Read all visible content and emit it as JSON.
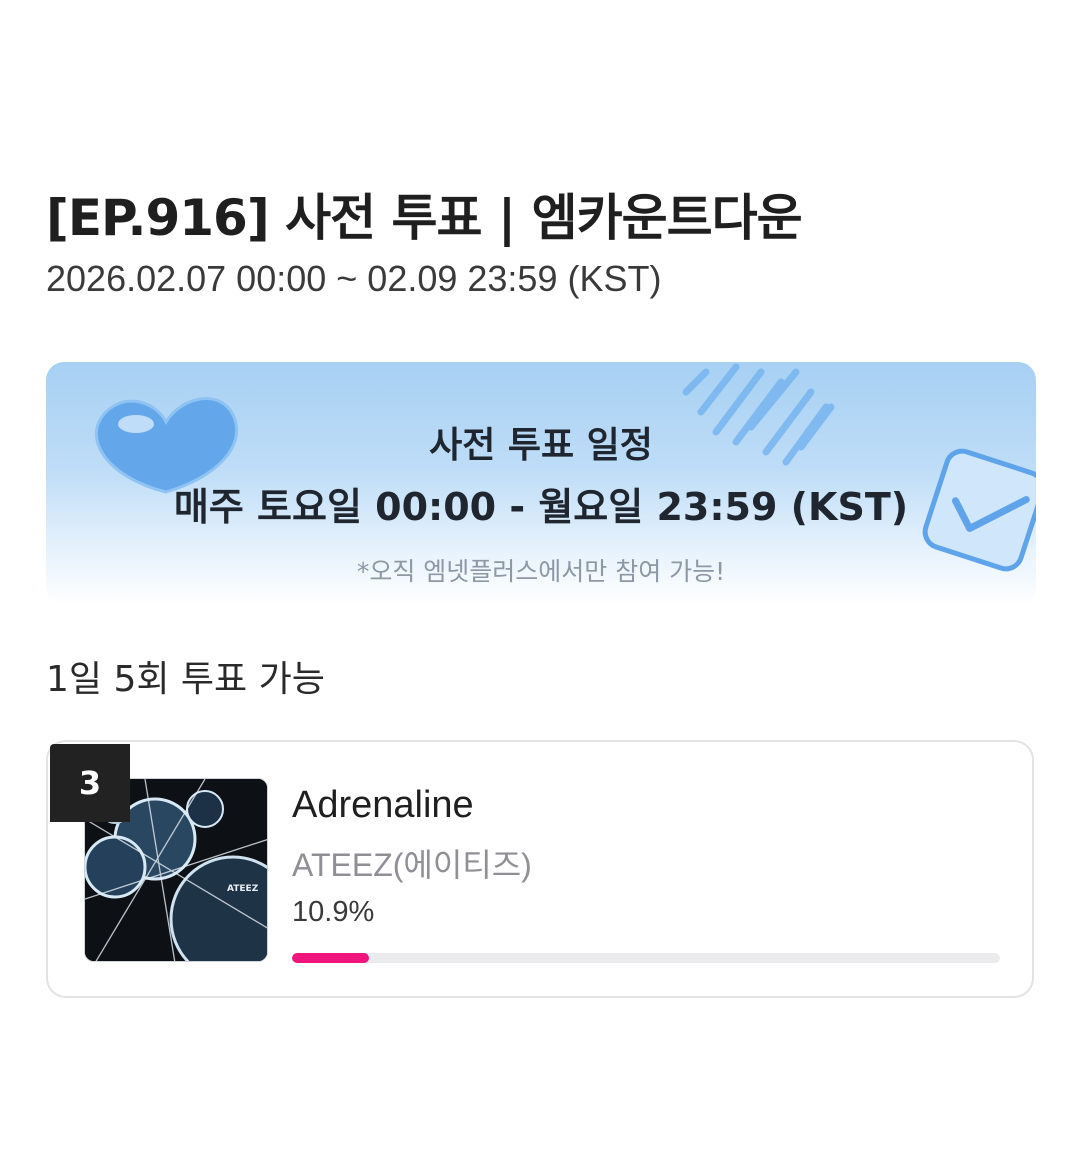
{
  "header": {
    "title": "[EP.916] 사전 투표 | 엠카운트다운",
    "period": "2026.02.07 00:00 ~ 02.09 23:59 (KST)"
  },
  "banner": {
    "title": "사전 투표 일정",
    "schedule": "매주 토요일 00:00 - 월요일 23:59 (KST)",
    "note": "*오직 엠넷플러스에서만 참여 가능!",
    "decorations": [
      "heart-icon",
      "checkbox-icon",
      "sound-wave"
    ]
  },
  "vote": {
    "limit_text": "1일 5회 투표 가능"
  },
  "candidates": [
    {
      "rank": "3",
      "title": "Adrenaline",
      "artist": "ATEEZ(에이티즈)",
      "percent_label": "10.9%",
      "percent_value": 10.9,
      "album_icon": "album-cover"
    }
  ],
  "colors": {
    "accent": "#f0147d",
    "banner_top": "#a7d0f3",
    "rank_bg": "#222222"
  }
}
